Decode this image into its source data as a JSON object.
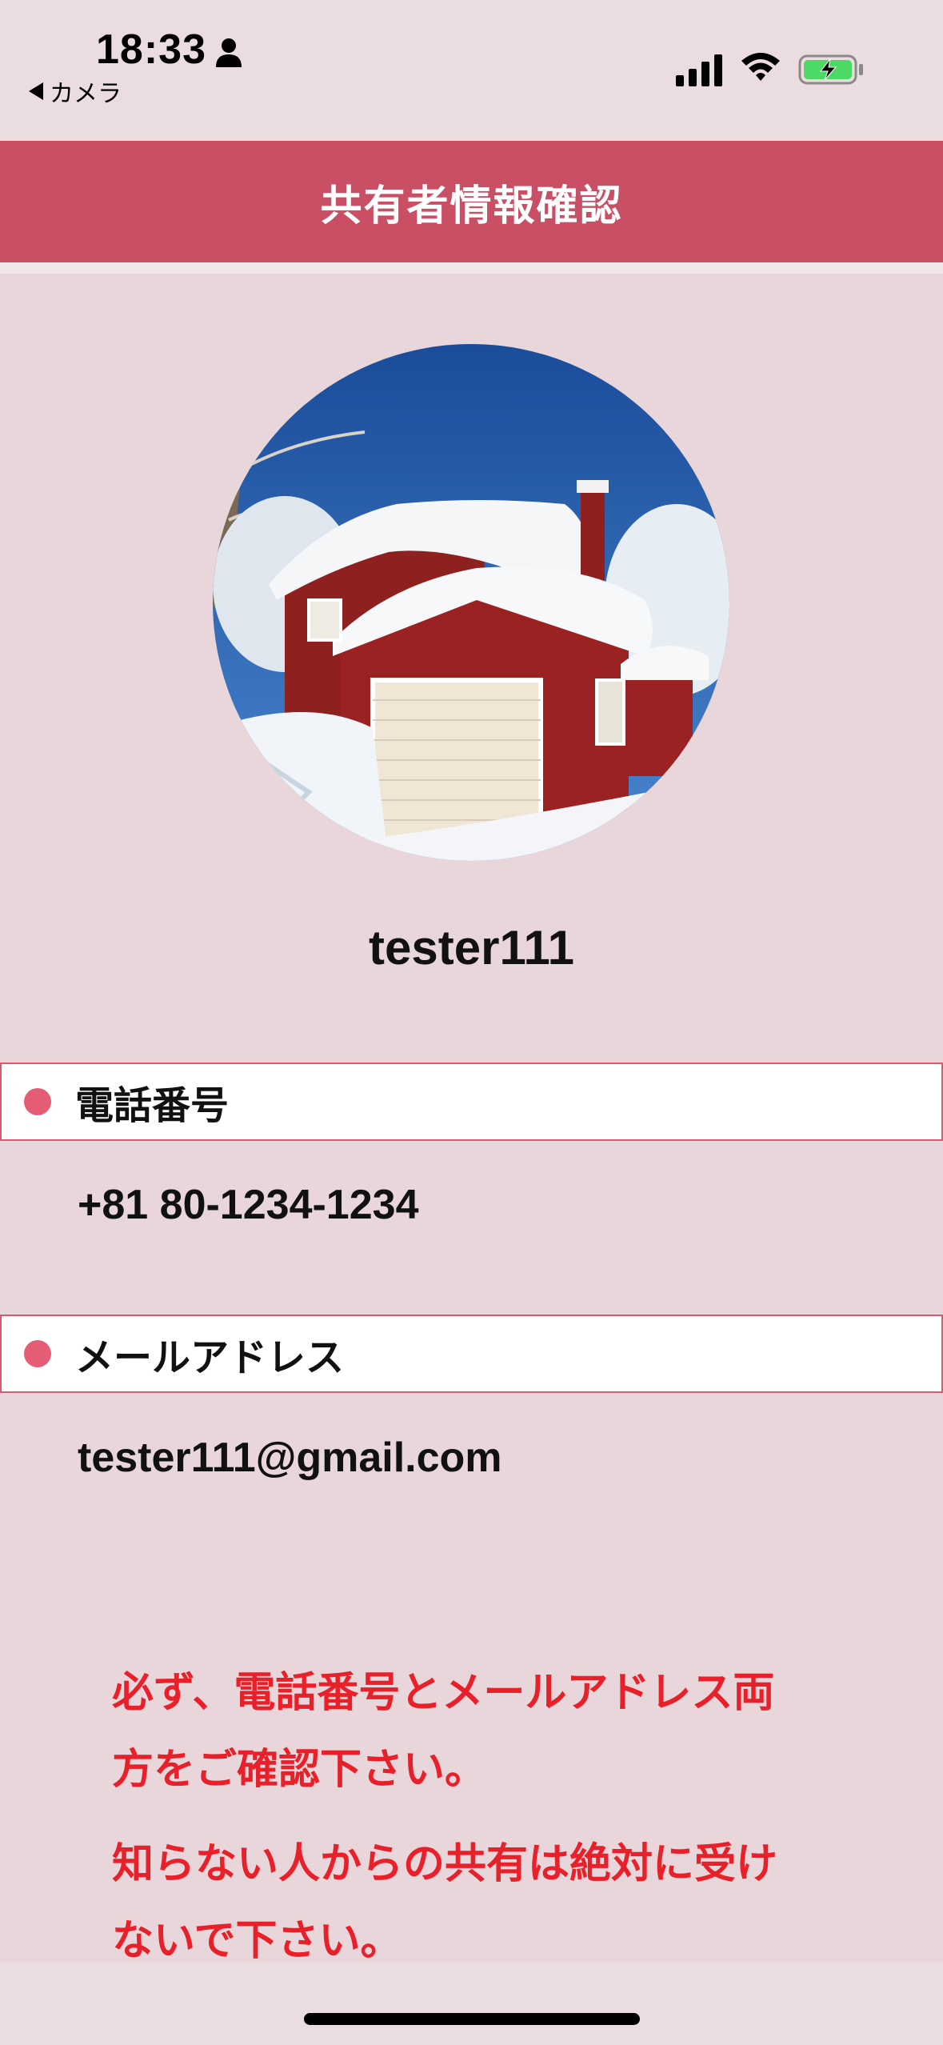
{
  "status_bar": {
    "time": "18:33",
    "back_label": "カメラ",
    "icons": [
      "person-icon",
      "signal-icon",
      "wifi-icon",
      "battery-charging-icon"
    ]
  },
  "header": {
    "title": "共有者情報確認"
  },
  "profile": {
    "username": "tester111",
    "avatar": "snowy-red-house-photo"
  },
  "phone": {
    "label": "電話番号",
    "value": "+81 80-1234-1234"
  },
  "email": {
    "label": "メールアドレス",
    "value": "tester111@gmail.com"
  },
  "warnings": {
    "line1": "必ず、電話番号とメールアドレス両",
    "line2": "方をご確認下さい。",
    "line3": "知らない人からの共有は絶対に受け",
    "line4": "ないで下さい。"
  },
  "colors": {
    "header": "#c84f64",
    "background": "#e8d6da",
    "bullet": "#e55d75",
    "warning": "#e8202a",
    "battery": "#4cd964"
  }
}
